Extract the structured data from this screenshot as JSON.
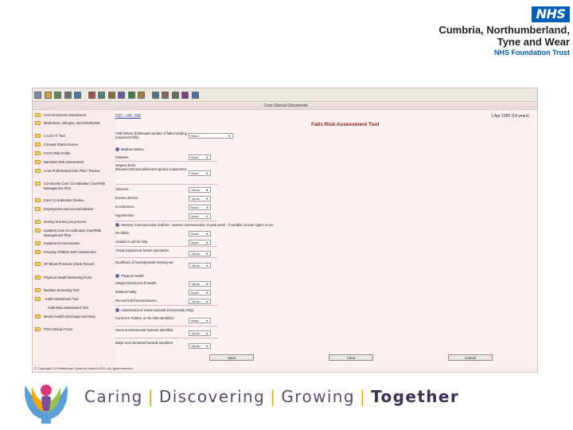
{
  "header": {
    "nhs_logo": "NHS",
    "trust_line1": "Cumbria, Northumberland,",
    "trust_line2": "Tyne and Wear",
    "trust_line3": "NHS Foundation Trust"
  },
  "colors": {
    "nhs_blue": "#005eb8",
    "form_bg": "#fbeaea",
    "title_red": "#8a2020",
    "slogan_purple": "#5c4a6e",
    "separator_orange": "#f0a500"
  },
  "app": {
    "toolbar_icons": [
      "home-icon",
      "open-icon",
      "save-icon",
      "print-icon",
      "refresh-icon",
      "mail-icon",
      "forward-icon",
      "user-icon",
      "calendar-icon",
      "report-icon",
      "chart-icon",
      "document-icon",
      "list-icon",
      "filter-icon",
      "edit-icon",
      "help-icon"
    ],
    "window_title": "Core Clinical Documents",
    "patient_id": "P2C, 145, 398",
    "dob": "1 Apr 1999 (14 years)",
    "form_title": "Falls Risk Assessment Tool",
    "sidebar": [
      "Core Document Assessment",
      "Medication, Allergies, and Sensitivities",
      "A.U.D.I.T. Tool",
      "Consent Status Screen",
      "FACE Risk Profile",
      "Narrative Risk Assessment",
      "Lead Professional Care Plan / Review",
      "Community Care Co-ordination Care/Risk Management Plan",
      "Care Co-ordination Review",
      "Employment and Accommodation",
      "Getting to know you process",
      "Inpatient Care Co-ordination Care/Risk Management Plan",
      "Inpatient Documentation",
      "Keeping Children Safe Assessment",
      "SP Blood Pressure Check Record",
      "Physical Health Monitoring Form",
      "Nutrition Screening Tool",
      "Falls Assessment Tool",
      "Falls Risk Assessment Tool",
      "Mental Health Discharge Summary",
      "Print Clinical Forms"
    ],
    "rows": {
      "falls_history": "Falls history (Estimated number of falls including suspected falls)",
      "medical_history": "Medical History",
      "diabetes": "Diabetes",
      "organic_brain": "Organic brain disease/confusion/delirium/cognitive impairment",
      "seizures": "Seizures",
      "excess_alcohol": "Excess alcohol",
      "incontinence": "Incontinence",
      "hypotension": "Hypotension",
      "sensory": "Sensory Communication Deficits - assess communication in past week - if variable choose higher score",
      "no_deficit": "No deficit",
      "unable_call": "Unable to call for help",
      "visual": "Visual impairment /wears spectacles",
      "deaf": "Deaf/hard of hearing/wears hearing aid",
      "physical_health": "Physical Health",
      "weight_loss": "Weight loss/recent ill health",
      "nocturia": "Marked Frailty",
      "recent_fracture": "Recent limb fracture/trauma",
      "home_hazards": "Assessment of Home Hazards (Community Only)",
      "current_patient": "Current in Patient, or No risks identified",
      "some_hazards": "Some environmental hazards identified",
      "major_hazards": "Major environmental hazards identified"
    },
    "select_values": {
      "none": "None",
      "none_dashed": "-None-"
    },
    "buttons": {
      "save": "Save",
      "clear": "Clear",
      "cancel": "Cancel"
    },
    "copyright": "© Copyright CIS Healthcare Systems Limited 2014. All rights reserved"
  },
  "footer": {
    "w1": "Caring",
    "w2": "Discovering",
    "w3": "Growing",
    "w4": "Together",
    "sep": "|"
  }
}
